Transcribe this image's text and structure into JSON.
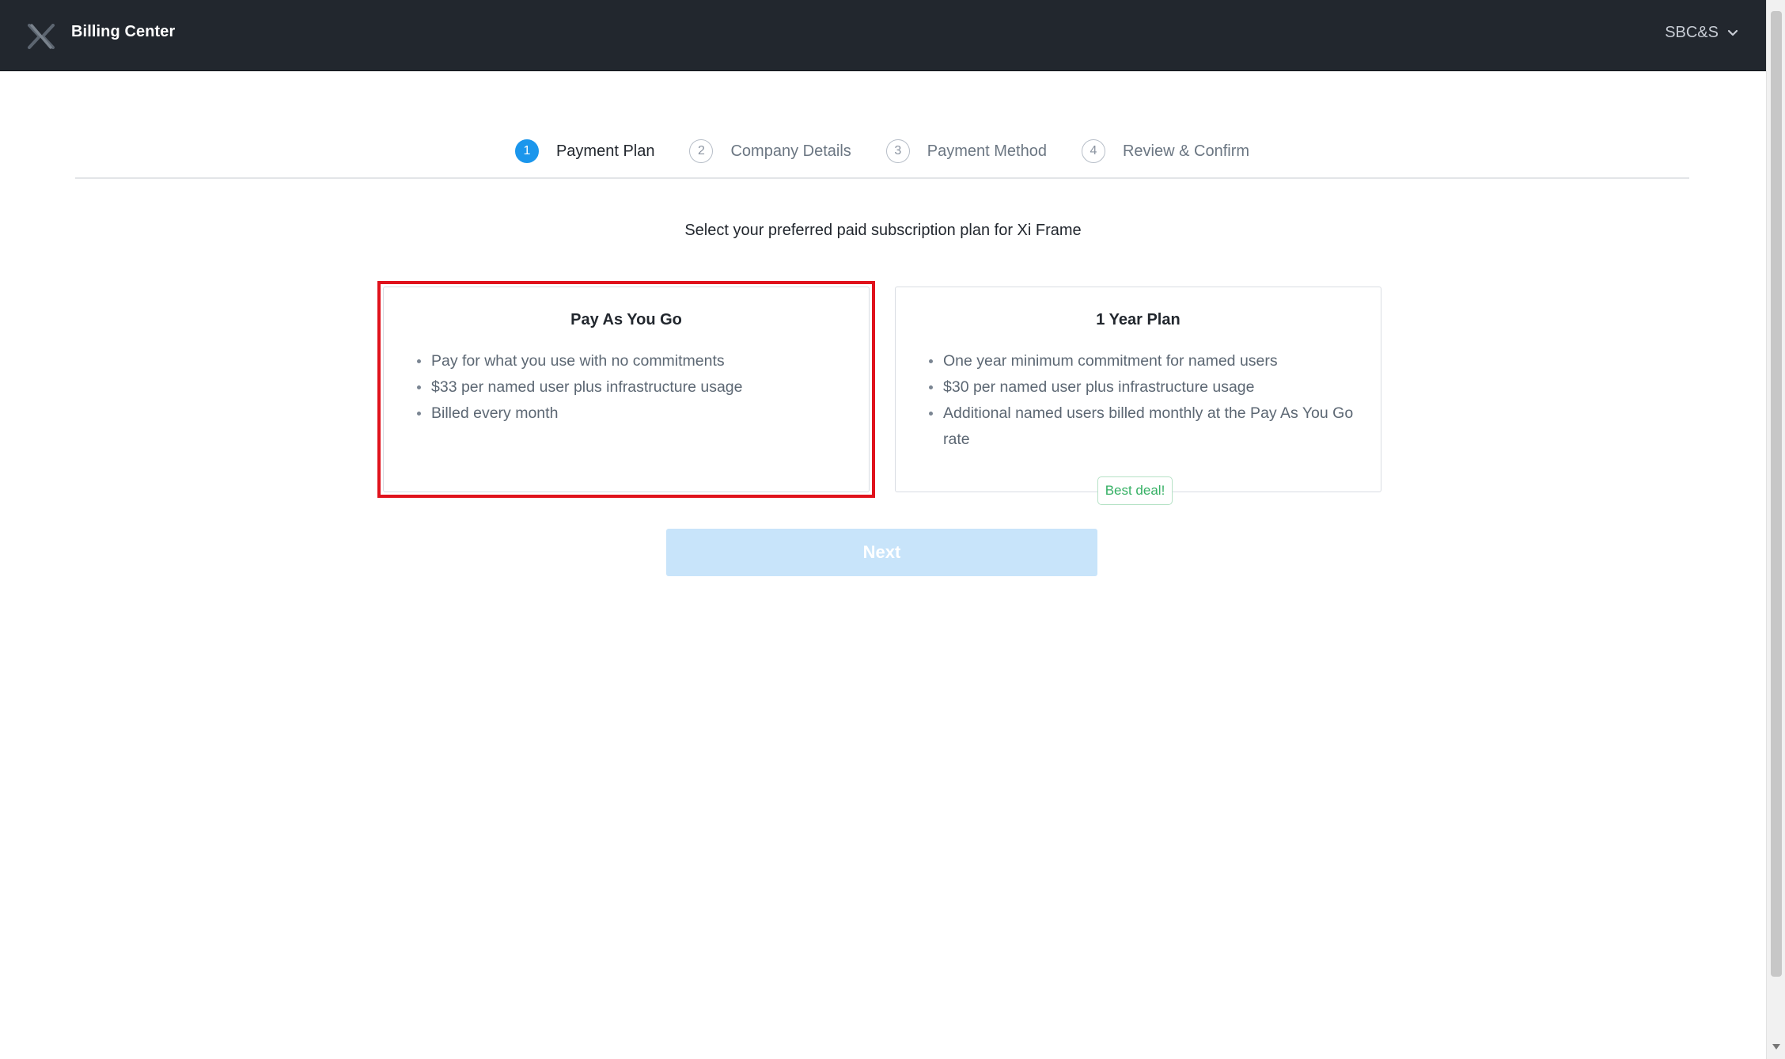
{
  "header": {
    "title": "Billing Center",
    "logo_icon": "x-logo-icon",
    "account_label": "SBC&S",
    "background": "#22272e"
  },
  "stepper": {
    "steps": [
      {
        "number": "1",
        "label": "Payment Plan",
        "active": true
      },
      {
        "number": "2",
        "label": "Company Details",
        "active": false
      },
      {
        "number": "3",
        "label": "Payment Method",
        "active": false
      },
      {
        "number": "4",
        "label": "Review & Confirm",
        "active": false
      }
    ],
    "active_color": "#1b96ec"
  },
  "main": {
    "heading": "Select your preferred paid subscription plan for Xi Frame",
    "plans": [
      {
        "title": "Pay As You Go",
        "features": [
          "Pay for what you use with no commitments",
          "$33 per named user plus infrastructure usage",
          "Billed every month"
        ],
        "highlighted": true
      },
      {
        "title": "1 Year Plan",
        "features": [
          "One year minimum commitment for named users",
          "$30 per named user plus infrastructure usage",
          "Additional named users billed monthly at the Pay As You Go rate"
        ],
        "badge": "Best deal!"
      }
    ],
    "next_label": "Next",
    "highlight_color": "#e0121c"
  }
}
